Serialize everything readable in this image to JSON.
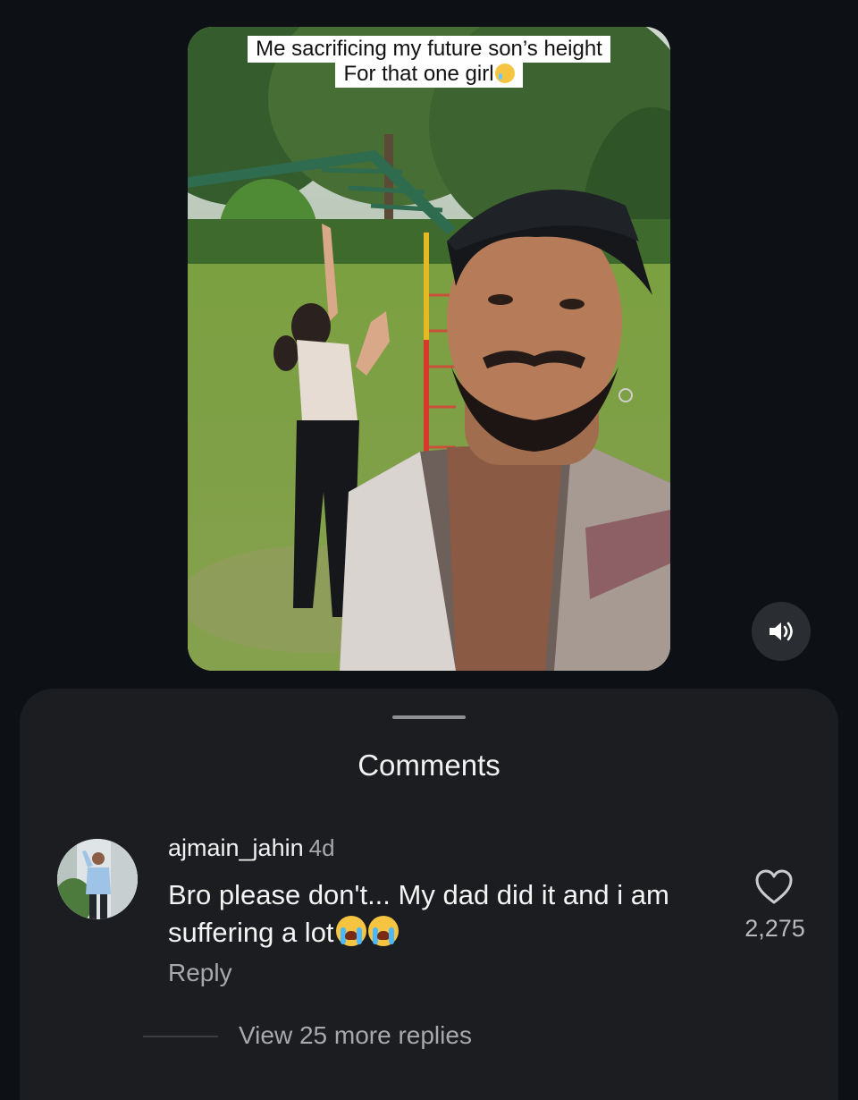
{
  "video": {
    "caption_line1": "Me sacrificing my future son’s height",
    "caption_line2": "For that one girl",
    "caption_emoji": "crying-face-emoji",
    "sound_icon": "speaker-sound-on-icon"
  },
  "comments_sheet": {
    "title": "Comments",
    "comments": [
      {
        "username": "ajmain_jahin",
        "time": "4d",
        "text": "Bro please don't... My dad did it and i am suffering a lot",
        "text_emojis": [
          "loudly-crying-face-emoji",
          "loudly-crying-face-emoji"
        ],
        "reply_label": "Reply",
        "like_icon": "heart-outline-icon",
        "like_count": "2,275",
        "view_replies_label": "View 25 more replies"
      }
    ]
  },
  "colors": {
    "background": "#0d1014",
    "sheet": "#1b1d20",
    "primary_text": "#f4f4f4",
    "secondary_text": "#a6a8ab"
  }
}
